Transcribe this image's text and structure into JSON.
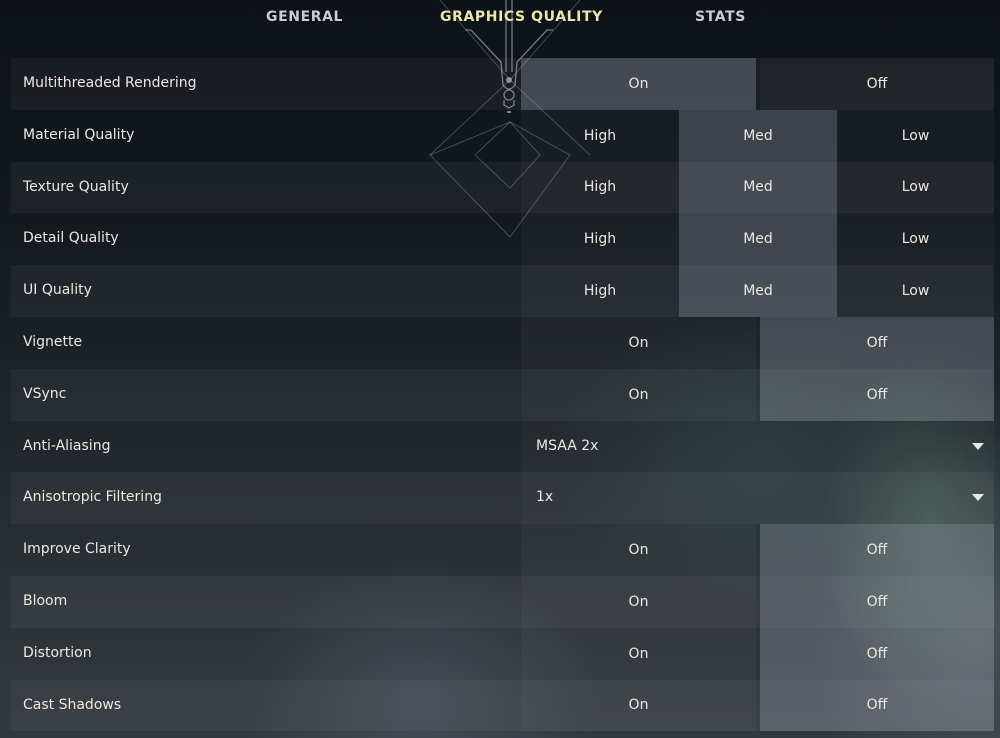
{
  "tabs": [
    {
      "label": "GENERAL",
      "active": false
    },
    {
      "label": "GRAPHICS QUALITY",
      "active": true
    },
    {
      "label": "STATS",
      "active": false
    }
  ],
  "colors": {
    "active_tab": "#ede6a8",
    "inactive_tab": "#c9ccd0",
    "text": "#ece8e1"
  },
  "settings": [
    {
      "label": "Multithreaded Rendering",
      "type": "toggle",
      "options": [
        "On",
        "Off"
      ],
      "selected": "On"
    },
    {
      "label": "Material Quality",
      "type": "choice3",
      "options": [
        "High",
        "Med",
        "Low"
      ],
      "selected": "Med"
    },
    {
      "label": "Texture Quality",
      "type": "choice3",
      "options": [
        "High",
        "Med",
        "Low"
      ],
      "selected": "Med"
    },
    {
      "label": "Detail Quality",
      "type": "choice3",
      "options": [
        "High",
        "Med",
        "Low"
      ],
      "selected": "Med"
    },
    {
      "label": "UI Quality",
      "type": "choice3",
      "options": [
        "High",
        "Med",
        "Low"
      ],
      "selected": "Med"
    },
    {
      "label": "Vignette",
      "type": "toggle",
      "options": [
        "On",
        "Off"
      ],
      "selected": "Off"
    },
    {
      "label": "VSync",
      "type": "toggle",
      "options": [
        "On",
        "Off"
      ],
      "selected": "Off"
    },
    {
      "label": "Anti-Aliasing",
      "type": "dropdown",
      "value": "MSAA 2x",
      "icon": "chevron-down-icon"
    },
    {
      "label": "Anisotropic Filtering",
      "type": "dropdown",
      "value": "1x",
      "icon": "chevron-down-icon"
    },
    {
      "label": "Improve Clarity",
      "type": "toggle",
      "options": [
        "On",
        "Off"
      ],
      "selected": "Off"
    },
    {
      "label": "Bloom",
      "type": "toggle",
      "options": [
        "On",
        "Off"
      ],
      "selected": "Off"
    },
    {
      "label": "Distortion",
      "type": "toggle",
      "options": [
        "On",
        "Off"
      ],
      "selected": "Off"
    },
    {
      "label": "Cast Shadows",
      "type": "toggle",
      "options": [
        "On",
        "Off"
      ],
      "selected": "Off"
    }
  ]
}
